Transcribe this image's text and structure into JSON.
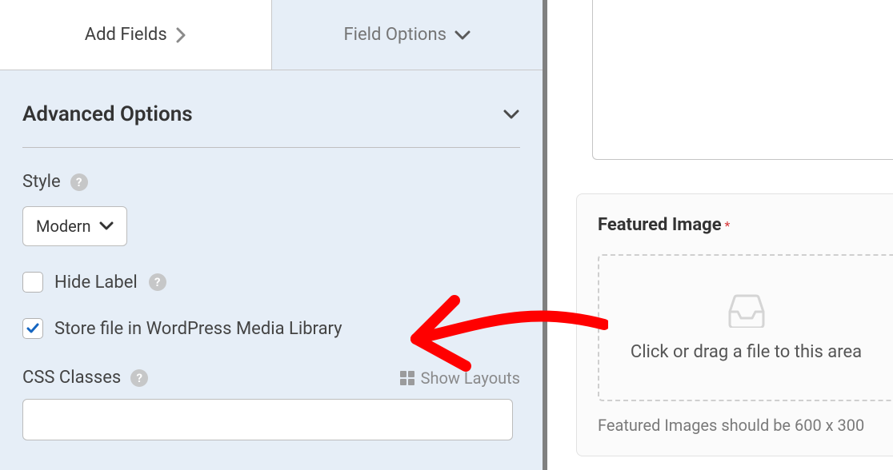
{
  "tabs": {
    "add_fields": "Add Fields",
    "field_options": "Field Options"
  },
  "section": {
    "title": "Advanced Options"
  },
  "style": {
    "label": "Style",
    "value": "Modern"
  },
  "hide_label": {
    "label": "Hide Label",
    "checked": false
  },
  "store_file": {
    "label": "Store file in WordPress Media Library",
    "checked": true
  },
  "css": {
    "label": "CSS Classes",
    "value": "",
    "show_layouts": "Show Layouts"
  },
  "preview": {
    "featured_label": "Featured Image",
    "required": "*",
    "dropzone_text": "Click or drag a file to this area",
    "note": "Featured Images should be 600 x 300"
  }
}
